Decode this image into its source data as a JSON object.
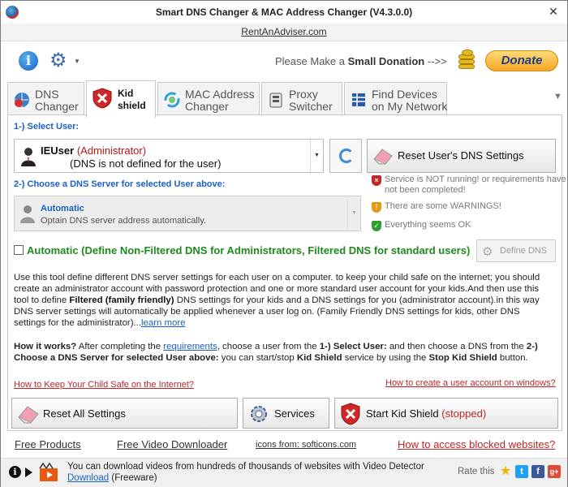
{
  "window": {
    "title": "Smart DNS Changer & MAC Address Changer (V4.3.0.0)"
  },
  "site_link": "RentAnAdviser.com",
  "donation": {
    "prefix": "Please Make a",
    "bold": "Small Donation",
    "suffix": "-->>",
    "button": "Donate"
  },
  "tabs": [
    {
      "label_1": "DNS",
      "label_2": "Changer",
      "icon": "dns-globe-icon"
    },
    {
      "label_1": "Kid",
      "label_2": "shield",
      "icon": "kid-shield-icon",
      "active": true
    },
    {
      "label_1": "MAC Address",
      "label_2": "Changer",
      "icon": "mac-refresh-icon"
    },
    {
      "label_1": "Proxy",
      "label_2": "Switcher",
      "icon": "proxy-icon"
    },
    {
      "label_1": "Find Devices",
      "label_2": "on My Network",
      "icon": "network-icon"
    }
  ],
  "step1": {
    "label": "1-) Select User:"
  },
  "user": {
    "name": "IEUser",
    "role": "(Administrator)",
    "dns_note": "(DNS is not defined for the user)"
  },
  "reset_user_btn": "Reset User's DNS Settings",
  "step2": {
    "label": "2-) Choose a DNS Server for selected User above:"
  },
  "dns_option": {
    "title": "Automatic",
    "desc": "Optain DNS server address automatically."
  },
  "status_legend": [
    {
      "text": "Service is NOT running! or requirements have not been completed!",
      "color": "#c42424",
      "icon": "shield-error-icon"
    },
    {
      "text": "There are some WARNINGS!",
      "color": "#e69a10",
      "icon": "shield-warning-icon"
    },
    {
      "text": "Everything seems OK",
      "color": "#2e9e2e",
      "icon": "shield-ok-icon"
    }
  ],
  "automatic_option": "Automatic (Define Non-Filtered DNS for Administrators, Filtered DNS for standard users)",
  "define_dns_btn": "Define DNS",
  "description": {
    "p1": "Use this tool define different DNS server settings for each user on a computer. to keep your child safe on the internet; you should create an administrator account with password protection and one or more standard user account for your kids.And then use this tool to define ",
    "p1_bold": "Filtered (family friendly)",
    "p2": " DNS settings for your kids and a DNS settings for you (administrator account).in this way DNS server settings will automatically be applied whenever a user log on. (Family Friendly DNS settings for kids, other DNS settings for the administrator)...",
    "learn_more": "learn more"
  },
  "how_it_works": {
    "h": "How it works?",
    "t1": " After completing the ",
    "req": "requirements",
    "t2": ", choose a user from the ",
    "b1": "1-) Select User:",
    "t3": " and then choose a DNS from the ",
    "b2": "2-) Choose a DNS Server for selected User above:",
    "t4": " you can start/stop ",
    "b3": "Kid Shield",
    "t5": " service by using the ",
    "b4": "Stop Kid Shield",
    "t6": " button."
  },
  "links": {
    "left": "How to Keep Your Child Safe on the Internet?",
    "right": "How to create a user account on windows?"
  },
  "bottom_buttons": {
    "reset_all": "Reset All Settings",
    "services": "Services",
    "start_kid": "Start Kid Shield",
    "start_kid_state": "(stopped)"
  },
  "footer": {
    "free_products": "Free Products",
    "free_video": "Free Video Downloader",
    "icons_from": "icons from: softicons.com",
    "blocked": "How to access blocked websites?"
  },
  "statusbar": {
    "line1": "You can download videos from hundreds of thousands of websites with Video Detector",
    "download": "Download",
    "freeware": "(Freeware)",
    "rate": "Rate this"
  },
  "colors": {
    "accent": "#1a5fc4",
    "error": "#c42424",
    "ok": "#1e8a1e"
  }
}
